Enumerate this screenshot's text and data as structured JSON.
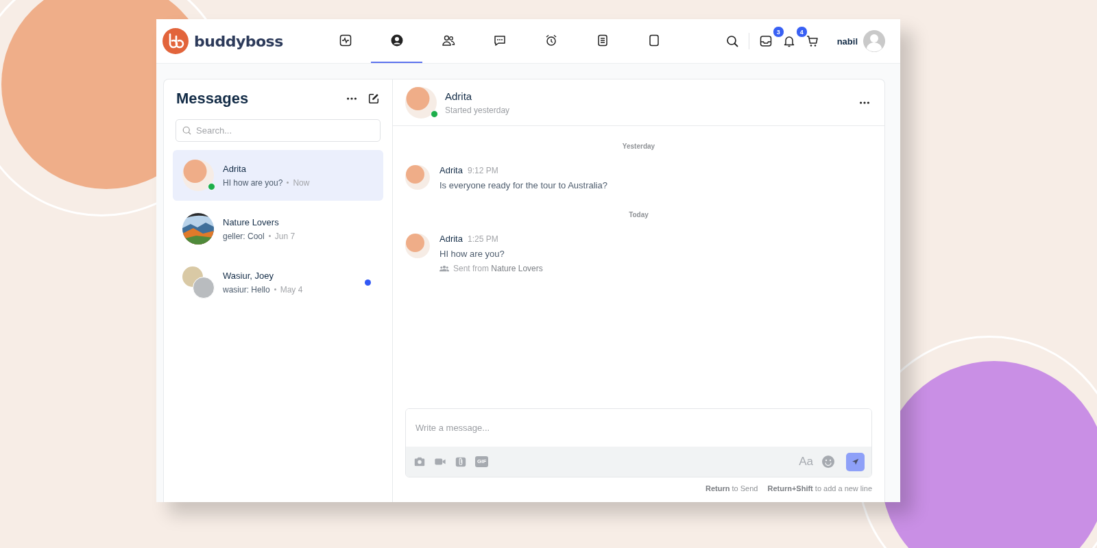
{
  "brand": {
    "name": "buddyboss"
  },
  "nav": [
    {
      "kind": "activity",
      "selected": false
    },
    {
      "kind": "profile",
      "selected": true
    },
    {
      "kind": "members",
      "selected": false
    },
    {
      "kind": "chat",
      "selected": false
    },
    {
      "kind": "alarm",
      "selected": false
    },
    {
      "kind": "document",
      "selected": false
    },
    {
      "kind": "page",
      "selected": false
    }
  ],
  "header": {
    "inbox_badge": "3",
    "notification_badge": "4",
    "user_name": "nabil"
  },
  "messages_panel": {
    "title": "Messages",
    "search_placeholder": "Search...",
    "threads": [
      {
        "name": "Adrita",
        "preview": "HI how are you?",
        "time": "Now",
        "selected": true,
        "online": true,
        "unread": false,
        "avatar": {
          "kind": "blob"
        }
      },
      {
        "name": "Nature Lovers",
        "preview": "geller: Cool",
        "time": "Jun 7",
        "selected": false,
        "online": false,
        "unread": false,
        "avatar": {
          "kind": "photo"
        }
      },
      {
        "name": "Wasiur, Joey",
        "preview": "wasiur: Hello",
        "time": "May 4",
        "selected": false,
        "online": false,
        "unread": true,
        "avatar": {
          "kind": "group"
        }
      }
    ]
  },
  "conversation": {
    "name": "Adrita",
    "subtitle": "Started yesterday",
    "online": true,
    "items": [
      {
        "kind": "date",
        "text": "Yesterday"
      },
      {
        "kind": "message",
        "author": "Adrita",
        "time": "9:12 PM",
        "text": "Is everyone ready for the tour to Australia?"
      },
      {
        "kind": "date",
        "text": "Today"
      },
      {
        "kind": "message",
        "author": "Adrita",
        "time": "1:25 PM",
        "text": "HI how are you?",
        "source": "Sent from **Nature Lovers**"
      }
    ]
  },
  "composer": {
    "placeholder": "Write a message...",
    "gif_label": "GIF",
    "format_label": "Aa",
    "hints": [
      "**Return** to Send",
      "**Return+Shift** to add a new line"
    ]
  }
}
